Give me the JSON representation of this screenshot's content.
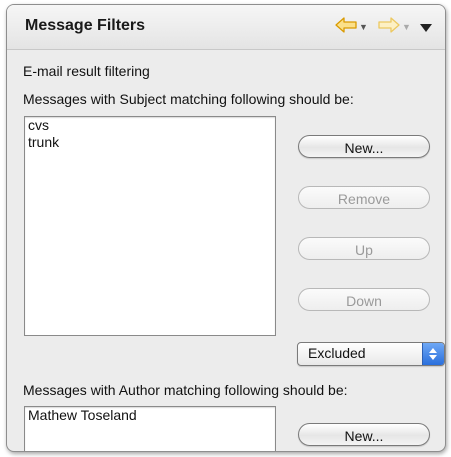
{
  "view": {
    "title": "Message Filters",
    "icons": {
      "back": "back-arrow-icon",
      "forward": "forward-arrow-icon",
      "menu": "view-menu-icon"
    },
    "colors": {
      "back_arrow": "#f0b400",
      "forward_arrow": "#f6d36a",
      "select_accent": "#2a6fdc"
    }
  },
  "email_filtering": {
    "section_label": "E-mail result filtering",
    "subject": {
      "label": "Messages with Subject matching following should be:",
      "items": [
        "cvs",
        "trunk"
      ],
      "buttons": {
        "new": "New...",
        "remove": "Remove",
        "up": "Up",
        "down": "Down"
      },
      "mode": "Excluded"
    },
    "author": {
      "label": "Messages with Author matching following should be:",
      "items": [
        "Mathew Toseland"
      ],
      "buttons": {
        "new": "New..."
      }
    }
  }
}
